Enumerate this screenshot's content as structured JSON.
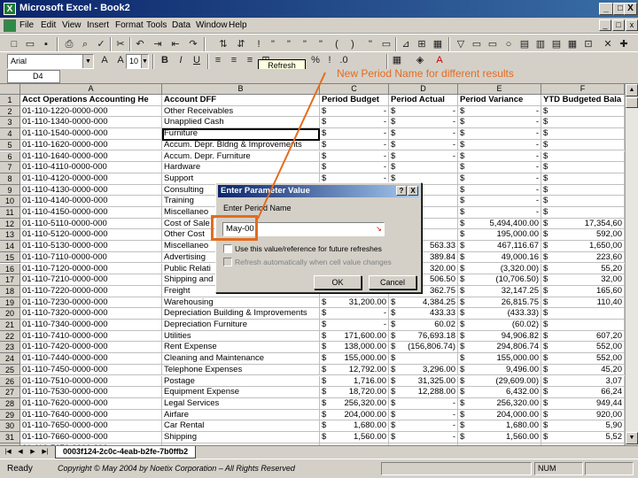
{
  "window": {
    "app_title": "Microsoft Excel - Book2",
    "minimize": "_",
    "restore": "□",
    "close": "X"
  },
  "menu": {
    "items": [
      "File",
      "Edit",
      "View",
      "Insert",
      "Format",
      "Tools",
      "Data",
      "Window",
      "Help"
    ],
    "doc_min": "_",
    "doc_restore": "□",
    "doc_close": "x"
  },
  "format_toolbar": {
    "font": "Arial",
    "size": "10",
    "tooltip": "Refresh Data"
  },
  "formula_bar": {
    "name_box": "D4"
  },
  "annotation": {
    "text": "New Period Name for different results",
    "color": "#e36c1f"
  },
  "grid": {
    "column_letters": [
      "A",
      "B",
      "C",
      "D",
      "E",
      "F"
    ],
    "header_row": [
      "Acct Operations Accounting He",
      "Account DFF",
      "Period Budget",
      "Period Actual",
      "Period Variance",
      "YTD Budgeted Bala"
    ],
    "row_numbers": [
      "1",
      "2",
      "3",
      "4",
      "5",
      "6",
      "7",
      "8",
      "9",
      "10",
      "11",
      "12",
      "13",
      "14",
      "15",
      "16",
      "17",
      "18",
      "19",
      "20",
      "21",
      "22",
      "23",
      "24",
      "25",
      "26",
      "27",
      "28",
      "29",
      "30",
      "31",
      "32"
    ],
    "rows": [
      [
        "01-110-1220-0000-000",
        "Other Receivables",
        "$",
        "-",
        "$",
        "-",
        "$",
        "-",
        "$",
        ""
      ],
      [
        "01-110-1340-0000-000",
        "Unapplied Cash",
        "$",
        "-",
        "$",
        "-",
        "$",
        "-",
        "$",
        ""
      ],
      [
        "01-110-1540-0000-000",
        "Furniture",
        "$",
        "-",
        "$",
        "-",
        "$",
        "-",
        "$",
        ""
      ],
      [
        "01-110-1620-0000-000",
        "Accum. Depr. Bldng & Improvements",
        "$",
        "-",
        "$",
        "-",
        "$",
        "-",
        "$",
        ""
      ],
      [
        "01-110-1640-0000-000",
        "Accum. Depr. Furniture",
        "$",
        "-",
        "$",
        "-",
        "$",
        "-",
        "$",
        ""
      ],
      [
        "01-110-4110-0000-000",
        "Hardware",
        "$",
        "-",
        "$",
        "",
        "$",
        "-",
        "$",
        ""
      ],
      [
        "01-110-4120-0000-000",
        "Support",
        "$",
        "-",
        "$",
        "",
        "$",
        "-",
        "$",
        ""
      ],
      [
        "01-110-4130-0000-000",
        "Consulting",
        "",
        "",
        "",
        "",
        "$",
        "-",
        "$",
        ""
      ],
      [
        "01-110-4140-0000-000",
        "Training",
        "",
        "",
        "",
        "",
        "$",
        "-",
        "$",
        ""
      ],
      [
        "01-110-4150-0000-000",
        "Miscellaneo",
        "",
        "",
        "",
        "",
        "$",
        "-",
        "$",
        ""
      ],
      [
        "01-110-5110-0000-000",
        "Cost of Sale",
        "",
        "",
        "",
        "",
        "$",
        "5,494,400.00",
        "$",
        "17,354,60"
      ],
      [
        "01-110-5120-0000-000",
        "Other Cost",
        "",
        "",
        "",
        "",
        "$",
        "195,000.00",
        "$",
        "592,00"
      ],
      [
        "01-110-5130-0000-000",
        "Miscellaneo",
        "",
        "",
        "",
        "563.33",
        "$",
        "467,116.67",
        "$",
        "1,650,00"
      ],
      [
        "01-110-7110-0000-000",
        "Advertising",
        "",
        "",
        "",
        "389.84",
        "$",
        "49,000.16",
        "$",
        "223,60"
      ],
      [
        "01-110-7120-0000-000",
        "Public Relati",
        "",
        "",
        "",
        "320.00",
        "$",
        "(3,320.00)",
        "$",
        "55,20"
      ],
      [
        "01-110-7210-0000-000",
        "Shipping and",
        "",
        "",
        "",
        "506.50",
        "$",
        "(10,706.50)",
        "$",
        "32,00"
      ],
      [
        "01-110-7220-0000-000",
        "Freight",
        "",
        "",
        "",
        "362.75",
        "$",
        "32,147.25",
        "$",
        "165,60"
      ],
      [
        "01-110-7230-0000-000",
        "Warehousing",
        "$",
        "31,200.00",
        "$",
        "4,384.25",
        "$",
        "26,815.75",
        "$",
        "110,40"
      ],
      [
        "01-110-7320-0000-000",
        "Depreciation Building & Improvements",
        "$",
        "-",
        "$",
        "433.33",
        "$",
        "(433.33)",
        "$",
        ""
      ],
      [
        "01-110-7340-0000-000",
        "Depreciation Furniture",
        "$",
        "-",
        "$",
        "60.02",
        "$",
        "(60.02)",
        "$",
        ""
      ],
      [
        "01-110-7410-0000-000",
        "Utilities",
        "$",
        "171,600.00",
        "$",
        "76,693.18",
        "$",
        "94,906.82",
        "$",
        "607,20"
      ],
      [
        "01-110-7420-0000-000",
        "Rent Expense",
        "$",
        "138,000.00",
        "$",
        "(156,806.74)",
        "$",
        "294,806.74",
        "$",
        "552,00"
      ],
      [
        "01-110-7440-0000-000",
        "Cleaning and Maintenance",
        "$",
        "155,000.00",
        "$",
        "",
        "$",
        "155,000.00",
        "$",
        "552,00"
      ],
      [
        "01-110-7450-0000-000",
        "Telephone Expenses",
        "$",
        "12,792.00",
        "$",
        "3,296.00",
        "$",
        "9,496.00",
        "$",
        "45,20"
      ],
      [
        "01-110-7510-0000-000",
        "Postage",
        "$",
        "1,716.00",
        "$",
        "31,325.00",
        "$",
        "(29,609.00)",
        "$",
        "3,07"
      ],
      [
        "01-110-7530-0000-000",
        "Equipment Expense",
        "$",
        "18,720.00",
        "$",
        "12,288.00",
        "$",
        "6,432.00",
        "$",
        "66,24"
      ],
      [
        "01-110-7620-0000-000",
        "Legal Services",
        "$",
        "256,320.00",
        "$",
        "-",
        "$",
        "256,320.00",
        "$",
        "949,44"
      ],
      [
        "01-110-7640-0000-000",
        "Airfare",
        "$",
        "204,000.00",
        "$",
        "-",
        "$",
        "204,000.00",
        "$",
        "920,00"
      ],
      [
        "01-110-7650-0000-000",
        "Car Rental",
        "$",
        "1,680.00",
        "$",
        "-",
        "$",
        "1,680.00",
        "$",
        "5,90"
      ],
      [
        "01-110-7660-0000-000",
        "Shipping",
        "$",
        "1,560.00",
        "$",
        "-",
        "$",
        "1,560.00",
        "$",
        "5,52"
      ],
      [
        "01-110-7670-0000-000",
        "",
        "",
        "",
        "",
        "",
        "",
        "",
        "",
        ""
      ]
    ]
  },
  "sheet_tab": {
    "label": "0003f124-2c0c-4eab-b2fe-7b0ffb2"
  },
  "status_bar": {
    "ready": "Ready",
    "copyright": "Copyright © May 2004 by Noetix Corporation – All Rights Reserved",
    "num": "NUM"
  },
  "dialog": {
    "title": "Enter Parameter Value",
    "help": "?",
    "close": "X",
    "prompt": "Enter Period Name",
    "value": "May-00",
    "check1": "Use this value/reference for future refreshes",
    "check2": "Refresh automatically when cell value changes",
    "ok": "OK",
    "cancel": "Cancel"
  }
}
